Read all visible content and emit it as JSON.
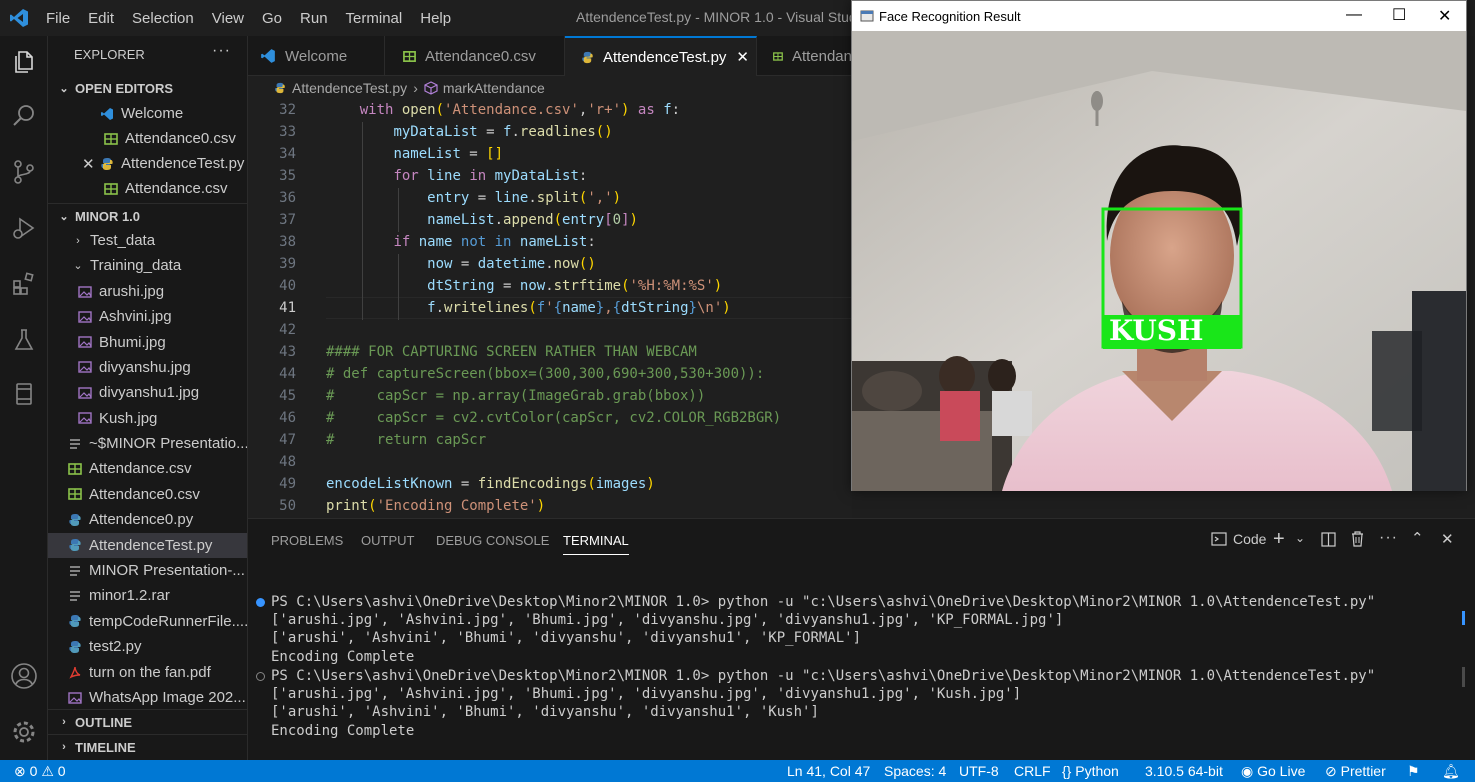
{
  "titlebar": {
    "menu": [
      "File",
      "Edit",
      "Selection",
      "View",
      "Go",
      "Run",
      "Terminal",
      "Help"
    ],
    "title": "AttendenceTest.py - MINOR 1.0 - Visual Studi"
  },
  "sidebar": {
    "header": "EXPLORER",
    "open_editors_label": "OPEN EDITORS",
    "open_editors": [
      "Welcome",
      "Attendance0.csv",
      "AttendenceTest.py",
      "Attendance.csv"
    ],
    "workspace_label": "MINOR 1.0",
    "folders": [
      "Test_data",
      "Training_data"
    ],
    "training_files": [
      "arushi.jpg",
      "Ashvini.jpg",
      "Bhumi.jpg",
      "divyanshu.jpg",
      "divyanshu1.jpg",
      "Kush.jpg"
    ],
    "root_files": [
      "~$MINOR Presentatio...",
      "Attendance.csv",
      "Attendance0.csv",
      "Attendence0.py",
      "AttendenceTest.py",
      "MINOR Presentation-...",
      "minor1.2.rar",
      "tempCodeRunnerFile....",
      "test2.py",
      "turn on the fan.pdf",
      "WhatsApp Image 202..."
    ],
    "outline_label": "OUTLINE",
    "timeline_label": "TIMELINE"
  },
  "tabs": [
    "Welcome",
    "Attendance0.csv",
    "AttendenceTest.py",
    "Attendan"
  ],
  "breadcrumb": {
    "file": "AttendenceTest.py",
    "symbol": "markAttendance"
  },
  "editor": {
    "line_numbers": [
      "32",
      "33",
      "34",
      "35",
      "36",
      "37",
      "38",
      "39",
      "40",
      "41",
      "42",
      "43",
      "44",
      "45",
      "46",
      "47",
      "48",
      "49",
      "50"
    ],
    "comment_header": "#### FOR CAPTURING SCREEN RATHER THAN WEBCAM",
    "comment_lines": [
      "# def captureScreen(bbox=(300,300,690+300,530+300)):",
      "#     capScr = np.array(ImageGrab.grab(bbox))",
      "#     capScr = cv2.cvtColor(capScr, cv2.COLOR_RGB2BGR)",
      "#     return capScr"
    ]
  },
  "panel": {
    "tabs": [
      "PROBLEMS",
      "OUTPUT",
      "DEBUG CONSOLE",
      "TERMINAL"
    ],
    "shell_label": "Code",
    "terminal_lines": [
      "PS C:\\Users\\ashvi\\OneDrive\\Desktop\\Minor2\\MINOR 1.0> python -u \"c:\\Users\\ashvi\\OneDrive\\Desktop\\Minor2\\MINOR 1.0\\AttendenceTest.py\"",
      "['arushi.jpg', 'Ashvini.jpg', 'Bhumi.jpg', 'divyanshu.jpg', 'divyanshu1.jpg', 'KP_FORMAL.jpg']",
      "['arushi', 'Ashvini', 'Bhumi', 'divyanshu', 'divyanshu1', 'KP_FORMAL']",
      "Encoding Complete",
      "PS C:\\Users\\ashvi\\OneDrive\\Desktop\\Minor2\\MINOR 1.0> python -u \"c:\\Users\\ashvi\\OneDrive\\Desktop\\Minor2\\MINOR 1.0\\AttendenceTest.py\"",
      "['arushi.jpg', 'Ashvini.jpg', 'Bhumi.jpg', 'divyanshu.jpg', 'divyanshu1.jpg', 'Kush.jpg']",
      "['arushi', 'Ashvini', 'Bhumi', 'divyanshu', 'divyanshu1', 'Kush']",
      "Encoding Complete"
    ]
  },
  "statusbar": {
    "errors": "0",
    "warnings": "0",
    "position": "Ln 41, Col 47",
    "spaces": "Spaces: 4",
    "encoding": "UTF-8",
    "eol": "CRLF",
    "language": "Python",
    "interpreter": "3.10.5 64-bit",
    "golive": "Go Live",
    "prettier": "Prettier"
  },
  "face_window": {
    "title": "Face Recognition Result",
    "detected_name": "KUSH"
  },
  "colors": {
    "accent": "#0078d4",
    "box": "#19e619"
  }
}
